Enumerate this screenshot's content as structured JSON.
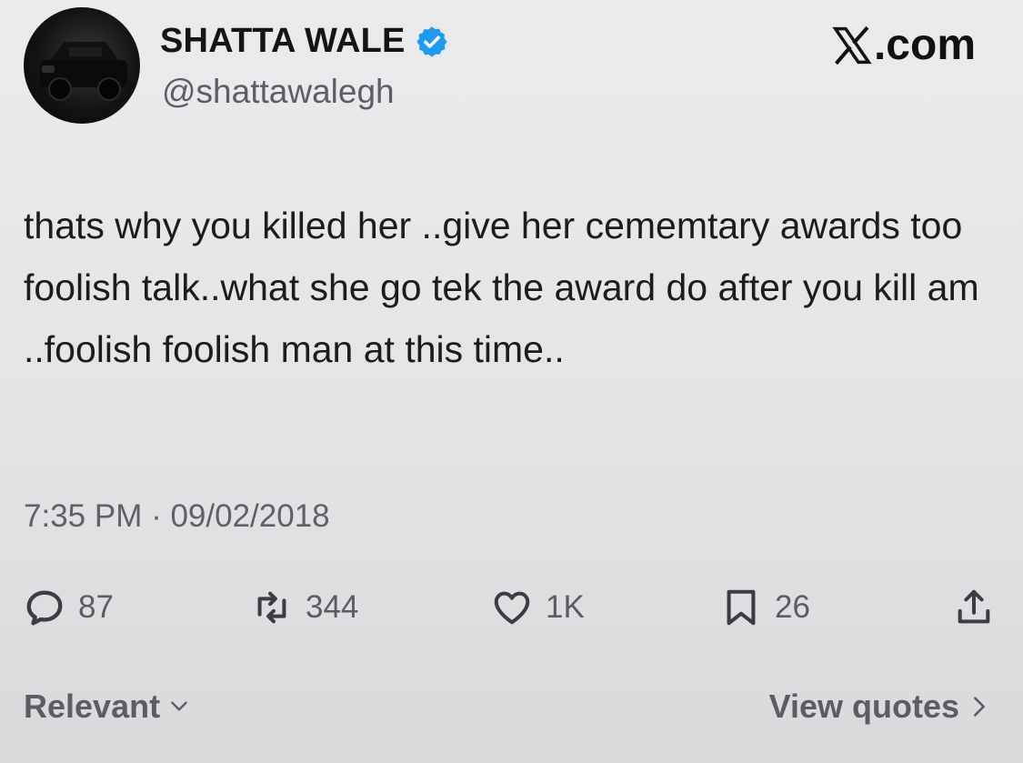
{
  "profile": {
    "display_name": "SHATTA WALE",
    "handle": "@shattawalegh",
    "verified": true,
    "avatar_icon": "car-photo-avatar"
  },
  "brand": {
    "label": ".com",
    "icon": "x-logo-icon"
  },
  "tweet": {
    "text": "thats why you killed her ..give her cememtary awards too foolish talk..what she go tek the award do after you kill am ..foolish foolish man at this time..",
    "timestamp": "7:35 PM · 09/02/2018"
  },
  "actions": {
    "replies": "87",
    "reposts": "344",
    "likes": "1K",
    "bookmarks": "26"
  },
  "footer": {
    "sort_label": "Relevant",
    "quotes_label": "View quotes"
  },
  "colors": {
    "verified_blue": "#1d9bf0",
    "muted_text": "#5b5f64",
    "background": "#e6e6e8"
  }
}
